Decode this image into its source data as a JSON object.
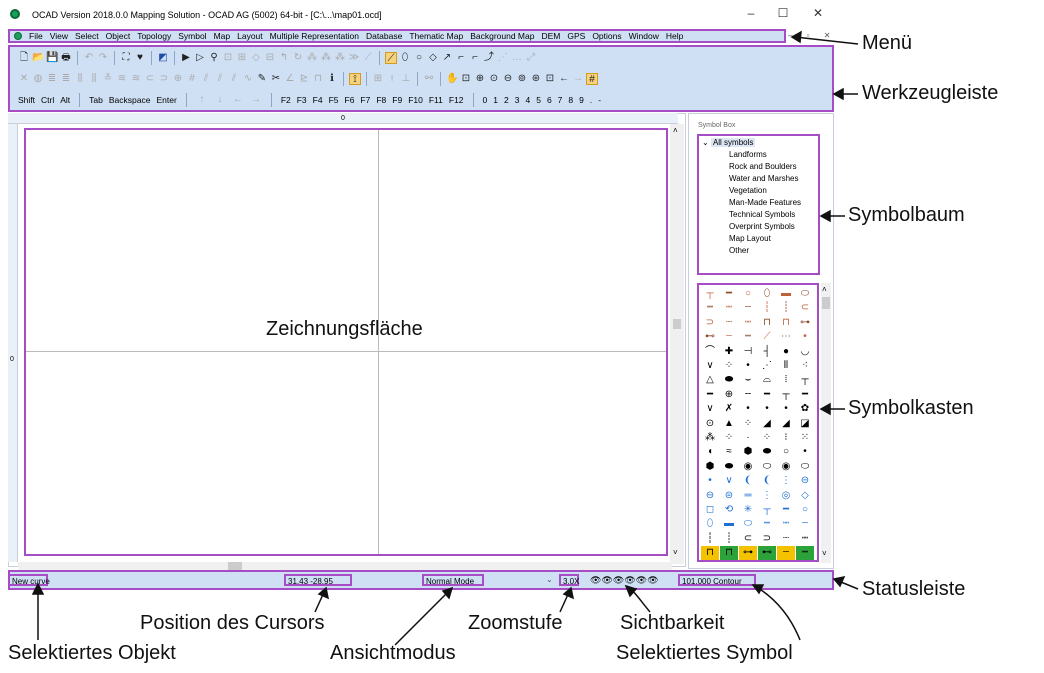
{
  "window": {
    "title": "OCAD Version 2018.0.0  Mapping Solution - OCAD AG (5002) 64-bit - [C:\\...\\map01.ocd]",
    "controls": [
      "–",
      "☐",
      "✕"
    ]
  },
  "menu": [
    "File",
    "View",
    "Select",
    "Object",
    "Topology",
    "Symbol",
    "Map",
    "Layout",
    "Multiple Representation",
    "Database",
    "Thematic Map",
    "Background Map",
    "DEM",
    "GPS",
    "Options",
    "Window",
    "Help"
  ],
  "mdi_controls": "– ▫ ✕",
  "keys_row": [
    "Shift",
    "Ctrl",
    "Alt",
    "Tab",
    "Backspace",
    "Enter"
  ],
  "fkeys": [
    "F2",
    "F3",
    "F4",
    "F5",
    "F6",
    "F7",
    "F8",
    "F9",
    "F10",
    "F11",
    "F12"
  ],
  "numkeys": [
    "0",
    "1",
    "2",
    "3",
    "4",
    "5",
    "6",
    "7",
    "8",
    "9",
    ".",
    "-"
  ],
  "ruler": {
    "top": "0",
    "left": "0"
  },
  "symbol_box": {
    "title": "Symbol Box",
    "root": "All symbols",
    "items": [
      "Landforms",
      "Rock and Boulders",
      "Water and Marshes",
      "Vegetation",
      "Man-Made Features",
      "Technical Symbols",
      "Overprint Symbols",
      "Map Layout",
      "Other"
    ]
  },
  "status": {
    "selected_object": "New curve",
    "cursor": "31.43   -28.95",
    "view_mode": "Normal Mode",
    "zoom": "3.0X",
    "selected_symbol": "101.000 Contour"
  },
  "annotations": {
    "menu": "Menü",
    "toolbar": "Werkzeugleiste",
    "symboltree": "Symbolbaum",
    "drawing": "Zeichnungsfläche",
    "symbolbox": "Symbolkasten",
    "statusbar": "Statusleiste",
    "cursor_pos": "Position des Cursors",
    "zoom": "Zoomstufe",
    "visibility": "Sichtbarkeit",
    "selected_object": "Selektiertes Objekt",
    "view_mode": "Ansichtmodus",
    "selected_symbol": "Selektiertes Symbol"
  },
  "colors": {
    "highlight": "#a64cc4",
    "bar": "#cfe0f5",
    "brand": "#1aa05a"
  }
}
